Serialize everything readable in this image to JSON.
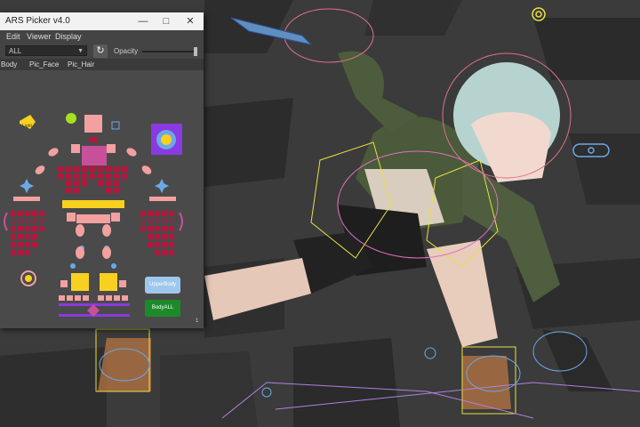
{
  "window": {
    "title": "ARS Picker v4.0"
  },
  "menu": [
    "Edit",
    "Viewer",
    "Display"
  ],
  "toolbar": {
    "dropdown_value": "ALL",
    "opacity_label": "Opacity"
  },
  "tabs": [
    "Body",
    "Pic_Face",
    "Pic_Hair"
  ],
  "buttons": {
    "upper_body": "UpperBody",
    "body_all": "BodyALL",
    "light": "Light"
  },
  "page_number": "1",
  "colors": {
    "pink": "#f2a0a0",
    "crimson": "#b8143c",
    "magenta": "#c8509a",
    "yellow": "#f8d020",
    "blue": "#6aa8e8",
    "purple": "#8a3ae0",
    "green": "#1d8a2a",
    "light_blue": "#9ec7ee"
  },
  "icons": [
    "close-icon",
    "maximize-icon",
    "minimize-icon",
    "refresh-icon",
    "gear-icon",
    "eye-icon",
    "move-cross-icon",
    "light-icon",
    "circle-target-icon"
  ]
}
